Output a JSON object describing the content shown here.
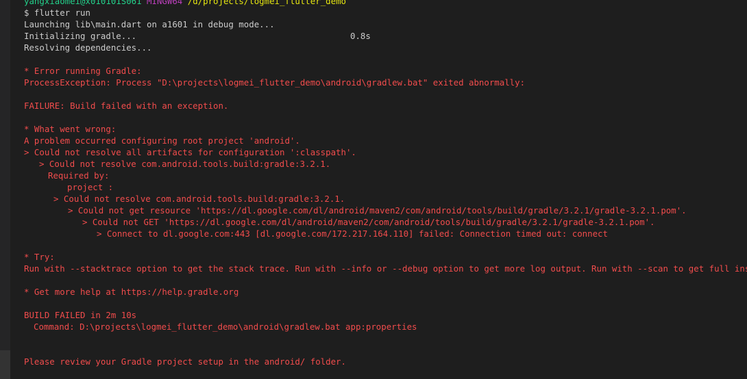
{
  "prompt": {
    "user": "yangxiaomei@x010101S061",
    "system": "MINGW64",
    "path": "/d/projects/logmei_flutter_demo"
  },
  "command": "$ flutter run",
  "launch": "Launching lib\\main.dart on a1601 in debug mode...",
  "init_gradle": "Initializing gradle...",
  "init_time": "0.8s",
  "resolving": "Resolving dependencies...",
  "errors": {
    "running": "* Error running Gradle:",
    "process": "ProcessException: Process \"D:\\projects\\logmei_flutter_demo\\android\\gradlew.bat\" exited abnormally:",
    "failure": "FAILURE: Build failed with an exception.",
    "what_wrong": "* What went wrong:",
    "problem": "A problem occurred configuring root project 'android'.",
    "classpath": "> Could not resolve all artifacts for configuration ':classpath'.",
    "resolve1": "> Could not resolve com.android.tools.build:gradle:3.2.1.",
    "required_by": "Required by:",
    "project": "project :",
    "resolve2": "> Could not resolve com.android.tools.build:gradle:3.2.1.",
    "get_resource": "> Could not get resource 'https://dl.google.com/dl/android/maven2/com/android/tools/build/gradle/3.2.1/gradle-3.2.1.pom'.",
    "could_not_get": "> Could not GET 'https://dl.google.com/dl/android/maven2/com/android/tools/build/gradle/3.2.1/gradle-3.2.1.pom'.",
    "connect": "> Connect to dl.google.com:443 [dl.google.com/172.217.164.110] failed: Connection timed out: connect",
    "try": "* Try:",
    "run_with": "Run with --stacktrace option to get the stack trace. Run with --info or --debug option to get more log output. Run with --scan to get full insights.",
    "more_help": "* Get more help at https://help.gradle.org",
    "build_failed": "BUILD FAILED in 2m 10s",
    "command": "Command: D:\\projects\\logmei_flutter_demo\\android\\gradlew.bat app:properties",
    "review": "Please review your Gradle project setup in the android/ folder."
  },
  "colors": {
    "background": "#1e1e1e",
    "text": "#cccccc",
    "error": "#f14c4c",
    "user": "#23d18b",
    "system": "#bc3fbc",
    "path": "#e5e510"
  }
}
